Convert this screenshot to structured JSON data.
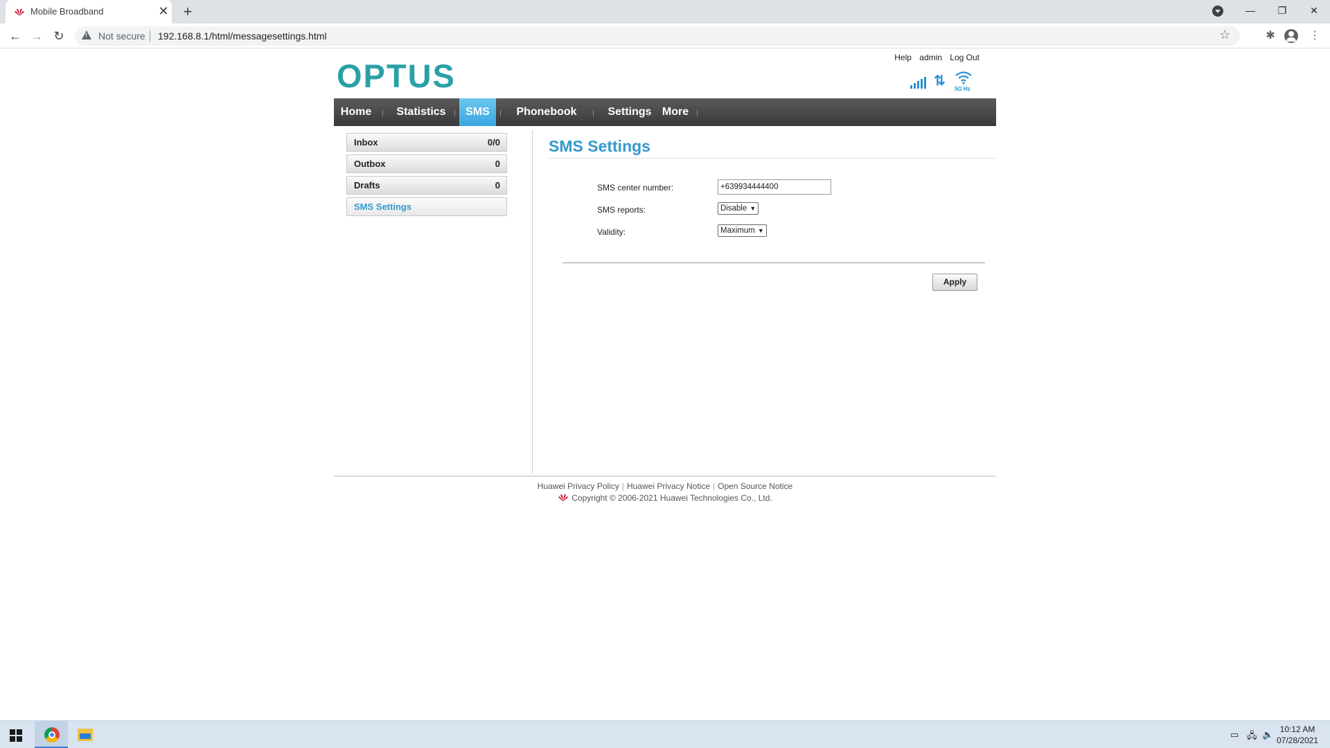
{
  "browser": {
    "tab_title": "Mobile Broadband",
    "tab_close": "✕",
    "new_tab": "+",
    "security_label": "Not secure",
    "url": "192.168.8.1/html/messagesettings.html",
    "window_controls": {
      "minimize": "—",
      "restore": "❐",
      "close": "✕"
    },
    "nav": {
      "back": "←",
      "forward": "→",
      "reload": "↻"
    },
    "star": "☆",
    "extensions": "✱",
    "menu": "⋮"
  },
  "header": {
    "logo": "OPTUS",
    "links": {
      "help": "Help",
      "user": "admin",
      "logout": "Log Out"
    },
    "wifi_band": "5G Hz",
    "data_icon": "⇅"
  },
  "nav": {
    "items": [
      {
        "label": "Home"
      },
      {
        "label": "Statistics"
      },
      {
        "label": "SMS",
        "active": true
      },
      {
        "label": "Phonebook"
      },
      {
        "label": "Settings"
      },
      {
        "label": "More"
      }
    ]
  },
  "sidebar": {
    "items": [
      {
        "label": "Inbox",
        "count": "0/0"
      },
      {
        "label": "Outbox",
        "count": "0"
      },
      {
        "label": "Drafts",
        "count": "0"
      },
      {
        "label": "SMS Settings",
        "active": true
      }
    ]
  },
  "main": {
    "title": "SMS Settings",
    "fields": {
      "center_number": {
        "label": "SMS center number:",
        "value": "+639934444400"
      },
      "reports": {
        "label": "SMS reports:",
        "value": "Disable"
      },
      "validity": {
        "label": "Validity:",
        "value": "Maximum"
      }
    },
    "apply_label": "Apply"
  },
  "footer": {
    "links": [
      "Huawei Privacy Policy",
      "Huawei Privacy Notice",
      "Open Source Notice"
    ],
    "copyright": "Copyright © 2006-2021 Huawei Technologies Co., Ltd."
  },
  "taskbar": {
    "time": "10:12 AM",
    "date": "07/28/2021"
  },
  "colors": {
    "brand": "#2aa0a8",
    "accent": "#3399cc",
    "nav_active": "#3aa7e0",
    "huawei_red": "#cf0a2c"
  }
}
